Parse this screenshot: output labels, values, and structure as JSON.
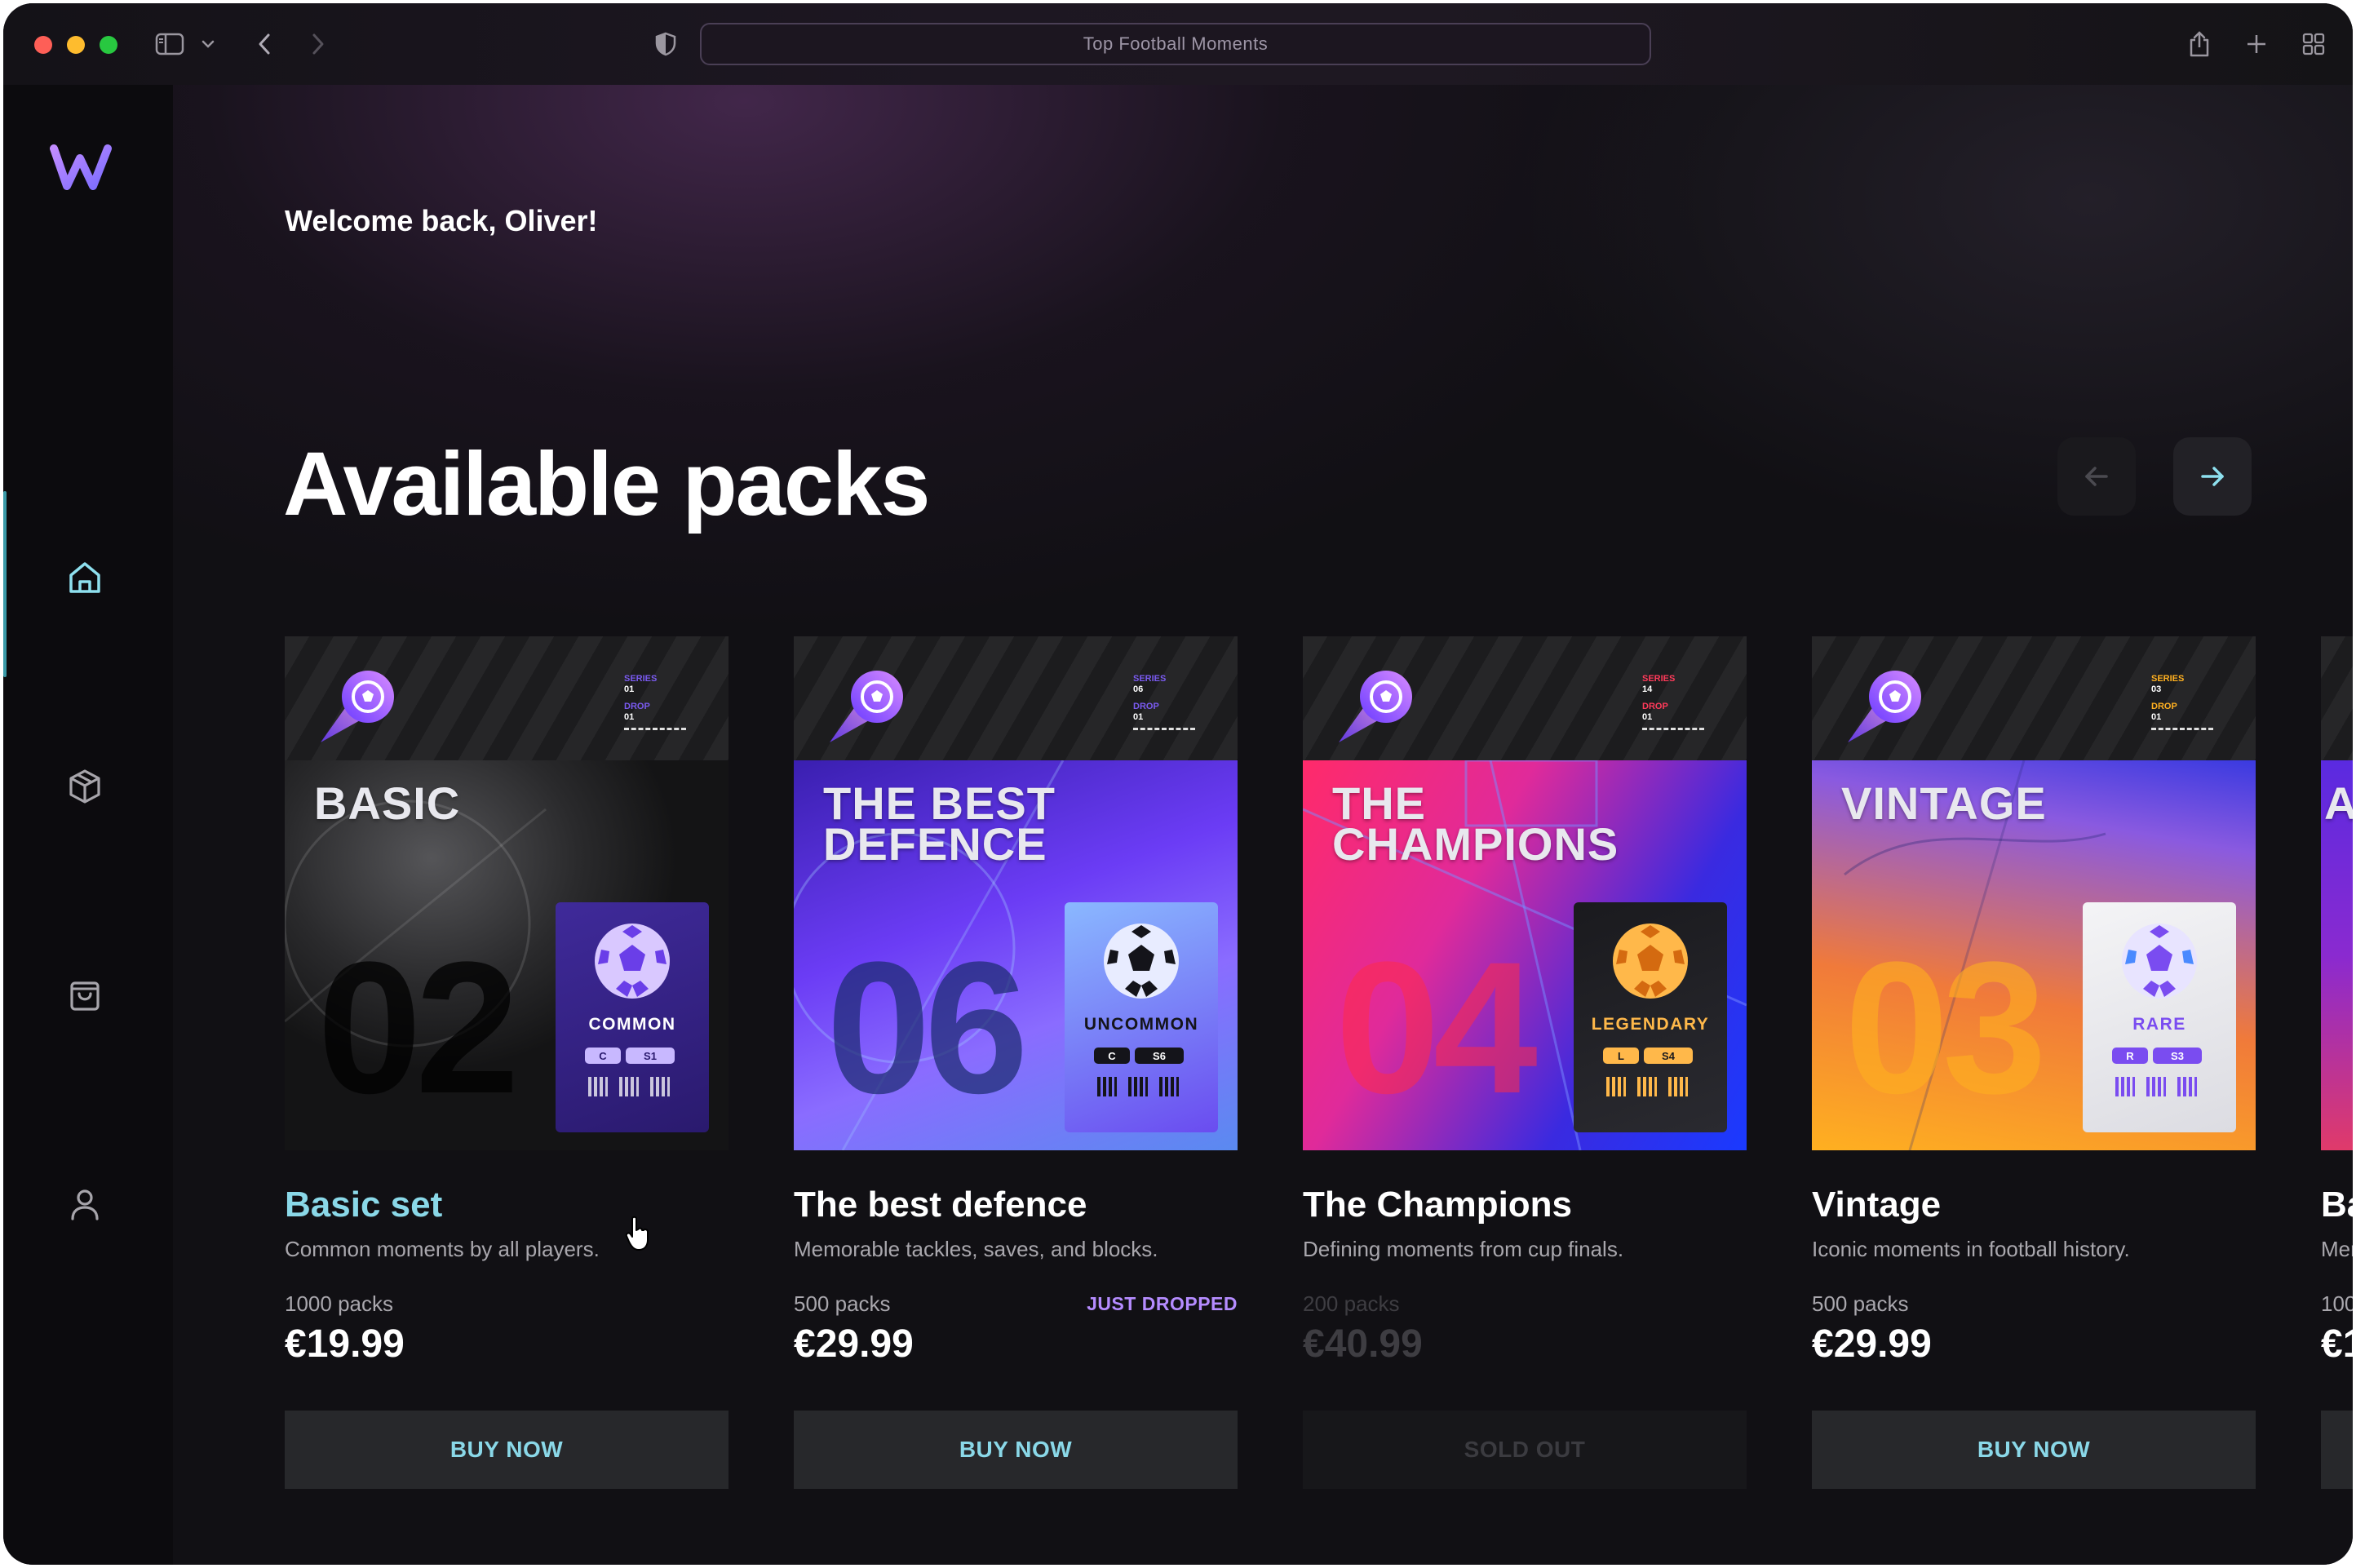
{
  "browser": {
    "url_title": "Top Football Moments",
    "colors": {
      "close": "#fe5f57",
      "minimize": "#febc2e",
      "zoom": "#28c840"
    },
    "icons": [
      "sidebar-toggle-icon",
      "chevron-down-icon",
      "back-icon",
      "forward-icon",
      "shield-icon",
      "share-icon",
      "plus-icon",
      "tab-overview-icon"
    ]
  },
  "sidebar": {
    "logo": "W",
    "items": [
      {
        "name": "home",
        "icon": "home-icon",
        "active": true
      },
      {
        "name": "packs",
        "icon": "cube-icon",
        "active": false
      },
      {
        "name": "shop",
        "icon": "shopping-bag-icon",
        "active": false
      },
      {
        "name": "profile",
        "icon": "user-icon",
        "active": false
      }
    ]
  },
  "main": {
    "welcome": "Welcome back, Oliver!",
    "heading": "Available packs",
    "packs": [
      {
        "art_title": "BASIC",
        "art_number": "02",
        "series_label": "SERIES",
        "series": "01",
        "drop_label": "DROP",
        "drop": "01",
        "rarity": "COMMON",
        "tag1": "C",
        "tag2": "S1",
        "name": "Basic set",
        "description": "Common moments by all players.",
        "count": "1000 packs",
        "badge": "",
        "price": "€19.99",
        "button": "BUY NOW"
      },
      {
        "art_title": "THE BEST DEFENCE",
        "art_number": "06",
        "series_label": "SERIES",
        "series": "06",
        "drop_label": "DROP",
        "drop": "01",
        "rarity": "UNCOMMON",
        "tag1": "C",
        "tag2": "S6",
        "name": "The best defence",
        "description": "Memorable tackles, saves, and blocks.",
        "count": "500 packs",
        "badge": "JUST DROPPED",
        "price": "€29.99",
        "button": "BUY NOW"
      },
      {
        "art_title": "THE CHAMPIONS",
        "art_number": "04",
        "series_label": "SERIES",
        "series": "14",
        "drop_label": "DROP",
        "drop": "01",
        "rarity": "LEGENDARY",
        "tag1": "L",
        "tag2": "S4",
        "name": "The Champions",
        "description": "Defining moments from cup finals.",
        "count": "200 packs",
        "badge": "",
        "price": "€40.99",
        "button": "SOLD OUT"
      },
      {
        "art_title": "VINTAGE",
        "art_number": "03",
        "series_label": "SERIES",
        "series": "03",
        "drop_label": "DROP",
        "drop": "01",
        "rarity": "RARE",
        "tag1": "R",
        "tag2": "S3",
        "name": "Vintage",
        "description": "Iconic moments in football history.",
        "count": "500 packs",
        "badge": "",
        "price": "€29.99",
        "button": "BUY NOW"
      },
      {
        "art_title": "A",
        "name": "Ba",
        "description": "Mer",
        "count": "100",
        "price": "€1"
      }
    ]
  }
}
